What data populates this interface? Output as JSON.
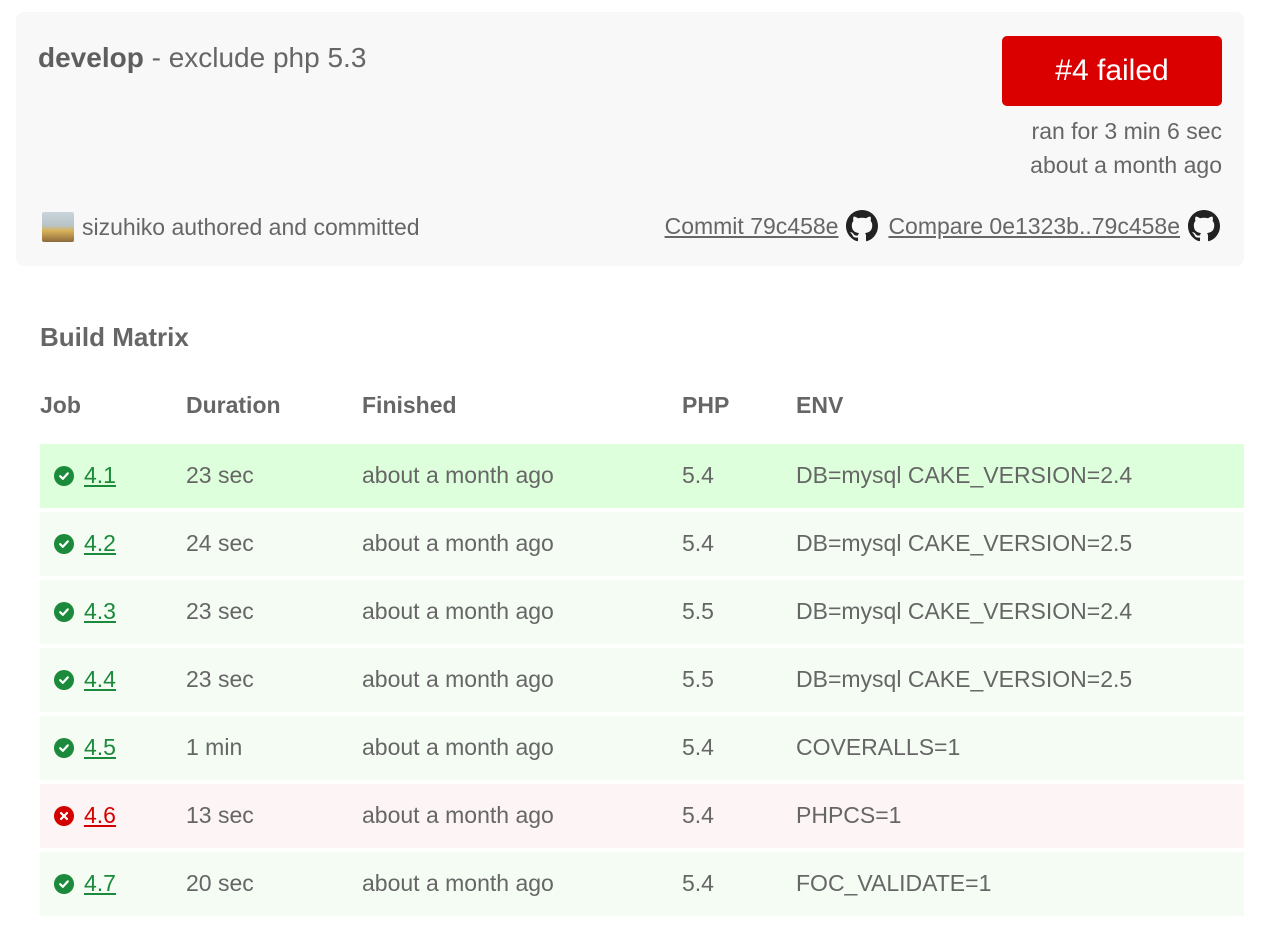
{
  "build": {
    "branch": "develop",
    "message": " - exclude php 5.3",
    "status_label": "#4 failed",
    "duration": "ran for 3 min 6 sec",
    "finished": "about a month ago",
    "author_text": "sizuhiko authored and committed",
    "commit_link": "Commit 79c458e",
    "compare_link": "Compare 0e1323b..79c458e"
  },
  "matrix": {
    "heading": "Build Matrix",
    "columns": {
      "job": "Job",
      "duration": "Duration",
      "finished": "Finished",
      "php": "PHP",
      "env": "ENV"
    },
    "rows": [
      {
        "job": "4.1",
        "state": "passed",
        "icon": "check-circle-icon",
        "duration": "23 sec",
        "finished": "about a month ago",
        "php": "5.4",
        "env": "DB=mysql CAKE_VERSION=2.4"
      },
      {
        "job": "4.2",
        "state": "passed",
        "icon": "check-circle-icon",
        "duration": "24 sec",
        "finished": "about a month ago",
        "php": "5.4",
        "env": "DB=mysql CAKE_VERSION=2.5"
      },
      {
        "job": "4.3",
        "state": "passed",
        "icon": "check-circle-icon",
        "duration": "23 sec",
        "finished": "about a month ago",
        "php": "5.5",
        "env": "DB=mysql CAKE_VERSION=2.4"
      },
      {
        "job": "4.4",
        "state": "passed",
        "icon": "check-circle-icon",
        "duration": "23 sec",
        "finished": "about a month ago",
        "php": "5.5",
        "env": "DB=mysql CAKE_VERSION=2.5"
      },
      {
        "job": "4.5",
        "state": "passed",
        "icon": "check-circle-icon",
        "duration": "1 min",
        "finished": "about a month ago",
        "php": "5.4",
        "env": "COVERALLS=1"
      },
      {
        "job": "4.6",
        "state": "failed",
        "icon": "x-circle-icon",
        "duration": "13 sec",
        "finished": "about a month ago",
        "php": "5.4",
        "env": "PHPCS=1"
      },
      {
        "job": "4.7",
        "state": "passed",
        "icon": "check-circle-icon",
        "duration": "20 sec",
        "finished": "about a month ago",
        "php": "5.4",
        "env": "FOC_VALIDATE=1"
      }
    ]
  },
  "colors": {
    "failed": "#db0000",
    "passed_text": "#1b8a3a",
    "passed_row": "#f4fcf4",
    "passed_row_highlight": "#deffdc",
    "failed_row": "#fdf5f5"
  }
}
